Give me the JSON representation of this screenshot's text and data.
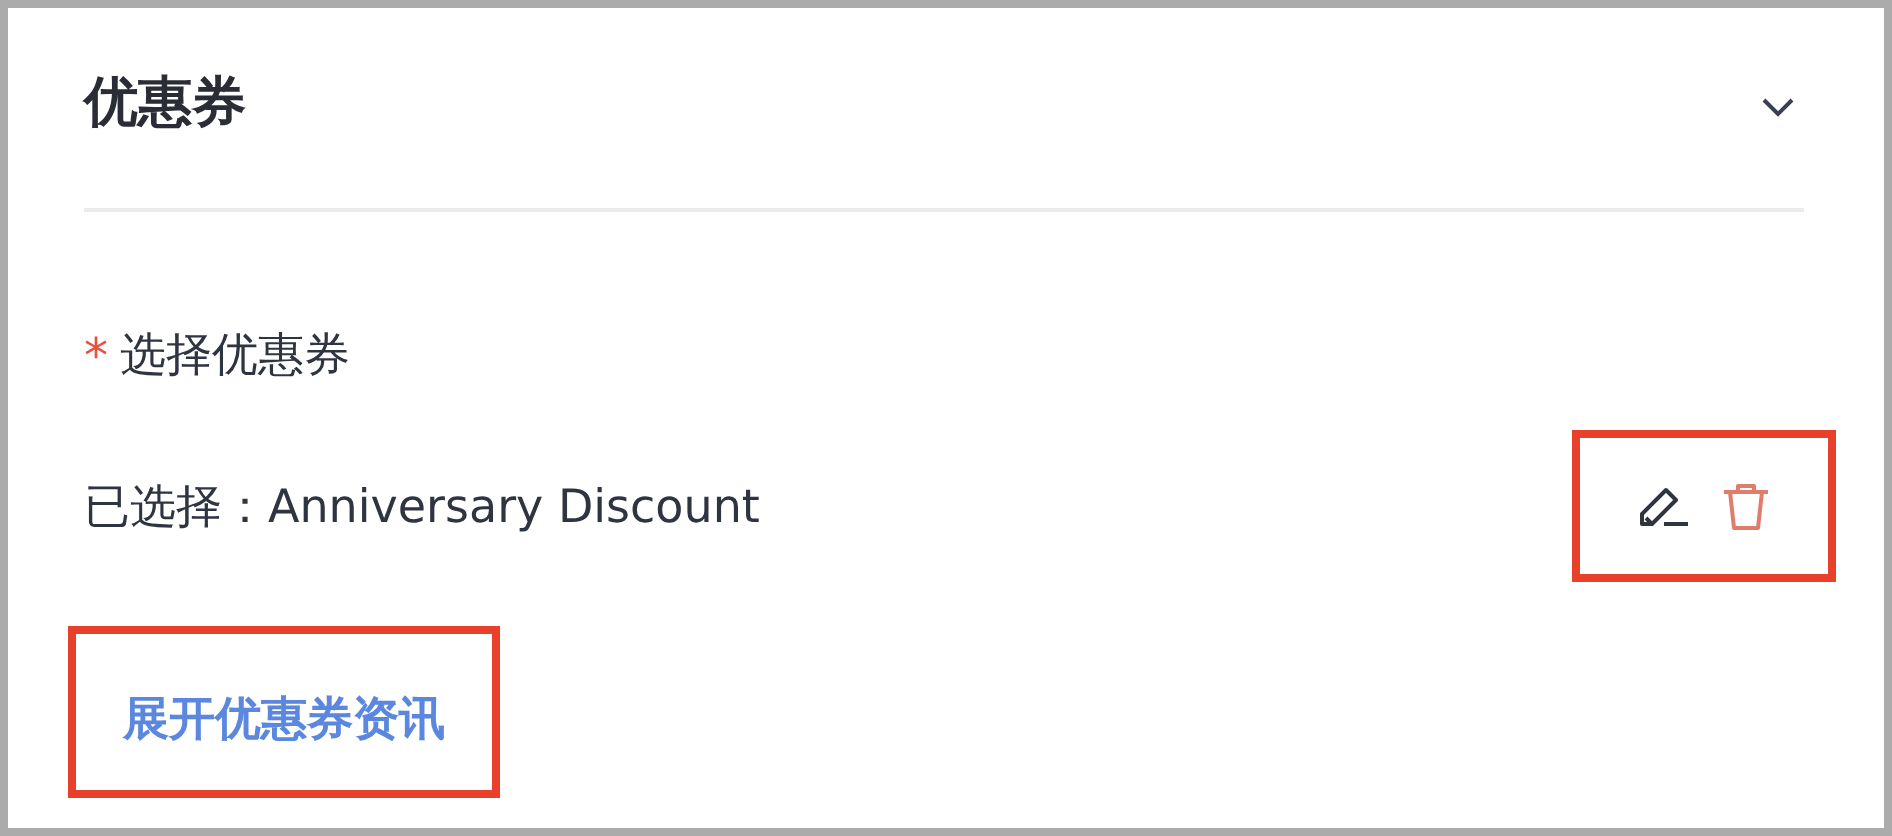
{
  "section": {
    "title": "优惠券"
  },
  "field": {
    "label": "选择优惠券",
    "required": true,
    "required_mark": "*"
  },
  "selection": {
    "text": "已选择：Anniversary Discount"
  },
  "link": {
    "label": "展开优惠券资讯"
  }
}
